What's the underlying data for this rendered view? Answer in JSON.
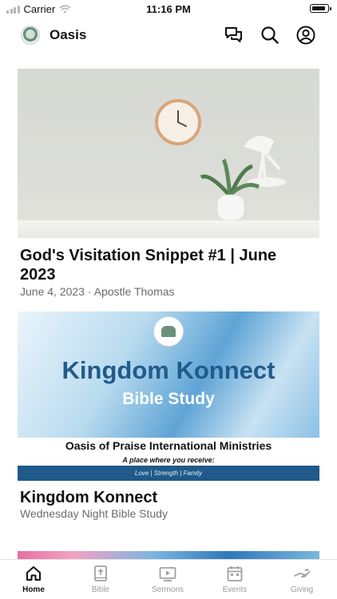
{
  "status_bar": {
    "carrier": "Carrier",
    "time": "11:16 PM",
    "battery_level": 0.9
  },
  "header": {
    "logo_icon": "church-seal-logo",
    "title": "Oasis",
    "actions": [
      {
        "icon": "chat-bubbles-icon"
      },
      {
        "icon": "search-icon"
      },
      {
        "icon": "user-account-icon"
      }
    ]
  },
  "feed": [
    {
      "image": "clock-lamp-plant-photo",
      "title": "God's Visitation Snippet #1 | June 2023",
      "subtitle": "June 4, 2023 · Apostle Thomas"
    },
    {
      "image": "kingdom-konnect-flyer",
      "flyer": {
        "seal_text": "Oasis of Praise",
        "heading": "Kingdom Konnect",
        "subheading": "Bible Study",
        "organization": "Oasis of Praise International Ministries",
        "tagline": "A place where you receive:",
        "strip": "Love | Strength | Family"
      },
      "title": "Kingdom Konnect",
      "subtitle": "Wednesday Night Bible Study"
    }
  ],
  "tabs": [
    {
      "label": "Home",
      "icon": "home-icon",
      "active": true
    },
    {
      "label": "Bible",
      "icon": "bible-icon",
      "active": false
    },
    {
      "label": "Sermons",
      "icon": "video-play-icon",
      "active": false
    },
    {
      "label": "Events",
      "icon": "calendar-icon",
      "active": false
    },
    {
      "label": "Giving",
      "icon": "giving-hand-icon",
      "active": false
    }
  ],
  "colors": {
    "accent": "#111111",
    "inactive_tab": "#9a9a9a",
    "flyer_blue": "#215b8a"
  }
}
